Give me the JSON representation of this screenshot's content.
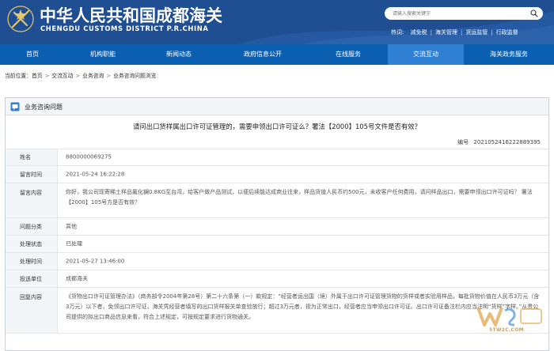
{
  "header": {
    "title": "中华人民共和国成都海关",
    "subtitle": "CHENGDU CUSTOMS DISTRICT P.R.CHINA",
    "search_placeholder": "请输入搜索关键字",
    "hot_label": "热词:",
    "hot_words": [
      "减免税",
      "海关管理",
      "货运监管",
      "行政监督"
    ]
  },
  "nav": {
    "items": [
      {
        "label": "首页",
        "active": false
      },
      {
        "label": "机构职能",
        "active": false
      },
      {
        "label": "新闻动态",
        "active": false
      },
      {
        "label": "政府信息公开",
        "active": false
      },
      {
        "label": "在线服务",
        "active": false
      },
      {
        "label": "交流互动",
        "active": true
      },
      {
        "label": "海关政务服务",
        "active": false
      }
    ]
  },
  "breadcrumb": {
    "prefix": "当前位置：",
    "items": [
      "首页",
      "交流互动",
      "业务咨询",
      "业务咨询问题浏览"
    ],
    "separator": ">"
  },
  "panel": {
    "heading": "业务咨询问题",
    "question_title": "请问出口货样属出口许可证管理的，需要申领出口许可证么？署法【2000】105号文件是否有效？",
    "number_label": "编号",
    "number": "20210524162228893​95",
    "rows": [
      {
        "label": "姓名",
        "value": "8800000069275"
      },
      {
        "label": "留言时间",
        "value": "2021-05-24 16:22:28"
      },
      {
        "label": "留言内容",
        "value": "你好，我公司现寄稀土样品氟化镧0.8KG至台湾，给客户做产品测试，以便后续能达成商业往来，样品货值人民币约500元，未收客户任何费用，请问样品出口，需要申领出口许可证吗？ 署法【2000】105号方是否有效？"
      },
      {
        "label": "问题分类",
        "value": "其他"
      },
      {
        "label": "处理状态",
        "value": "已处理"
      },
      {
        "label": "处理时间",
        "value": "2021-05-27 13:46:00"
      },
      {
        "label": "投送单位",
        "value": "成都海关"
      },
      {
        "label": "回复内容",
        "value": "《货物出口许可证管理办法》（商务部令2004年第28号）第二十六条第（一）款规定：“经营者运出国（境）外属于出口许可证管理货物的货样或者实验用样品，每批货物价值在人民币3万元（含3万元）以下者，免领出口许可证，海关凭经营者填写的出口货样报关单查验放行；超过3万元者，视为正常出口，经营者应当申领出口许可证。出口许可证备注栏内应当注明“货样”字样。”从贵公司提供的拟出口商品信息来看，符合上述规定，可按规定要求进行货物通关。"
      }
    ]
  },
  "watermark": {
    "text": "5TW2C.COM"
  },
  "colors": {
    "header_bg": "#1f4f92",
    "nav_bg": "#0b5fb1",
    "nav_active": "#2f7fd3"
  }
}
